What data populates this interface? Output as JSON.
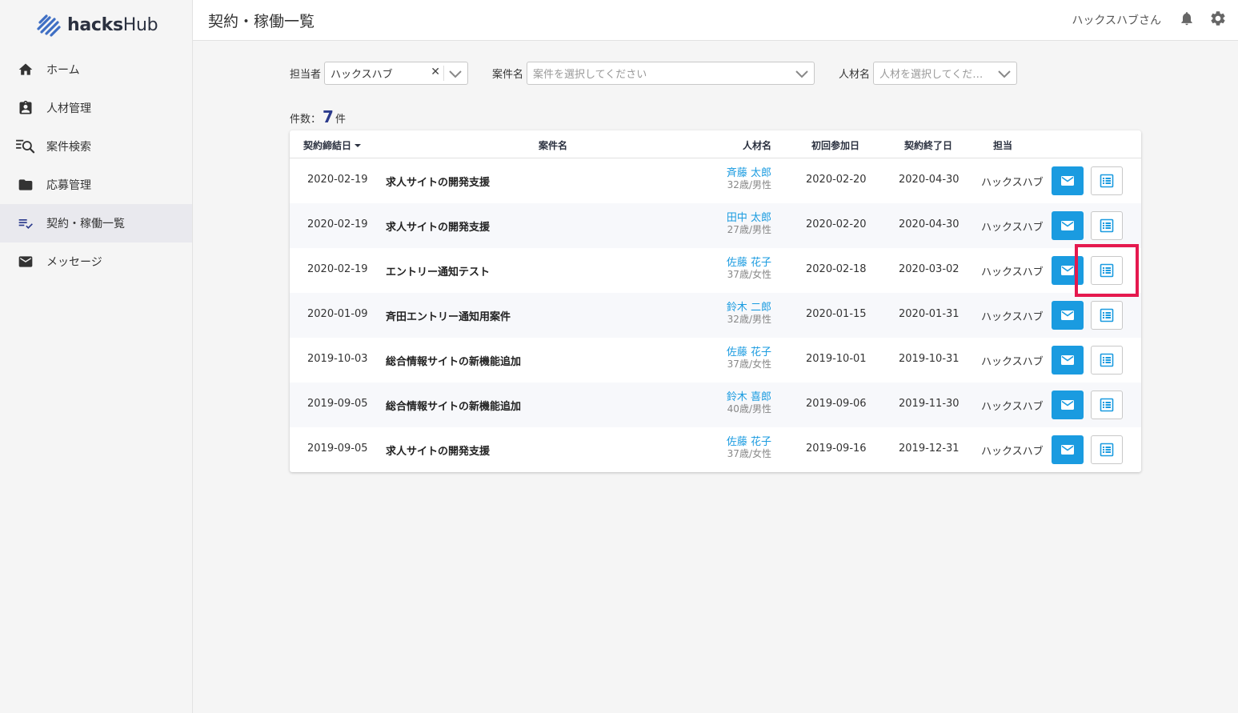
{
  "brand": {
    "name_bold": "hacks",
    "name_light": "Hub"
  },
  "sidebar": {
    "items": [
      {
        "label": "ホーム",
        "icon": "home-icon",
        "active": false
      },
      {
        "label": "人材管理",
        "icon": "badge-icon",
        "active": false
      },
      {
        "label": "案件検索",
        "icon": "search-list-icon",
        "active": false
      },
      {
        "label": "応募管理",
        "icon": "folder-icon",
        "active": false
      },
      {
        "label": "契約・稼働一覧",
        "icon": "checklist-icon",
        "active": true
      },
      {
        "label": "メッセージ",
        "icon": "mail-icon",
        "active": false
      }
    ]
  },
  "header": {
    "title": "契約・稼働一覧",
    "user": "ハックスハブさん"
  },
  "filters": {
    "manager_label": "担当者",
    "manager_value": "ハックスハブ",
    "project_label": "案件名",
    "project_placeholder": "案件を選択してください",
    "talent_label": "人材名",
    "talent_placeholder": "人材を選択してくだ…"
  },
  "count": {
    "prefix": "件数：",
    "value": "7",
    "suffix": "件"
  },
  "table": {
    "headers": {
      "contract_date": "契約締結日",
      "project": "案件名",
      "talent": "人材名",
      "first_day": "初回参加日",
      "end_date": "契約終了日",
      "manager": "担当"
    },
    "rows": [
      {
        "contract_date": "2020-02-19",
        "project": "求人サイトの開発支援",
        "name": "斉藤 太郎",
        "age_sex": "32歳/男性",
        "first_day": "2020-02-20",
        "end_date": "2020-04-30",
        "manager": "ハックスハブ"
      },
      {
        "contract_date": "2020-02-19",
        "project": "求人サイトの開発支援",
        "name": "田中 太郎",
        "age_sex": "27歳/男性",
        "first_day": "2020-02-20",
        "end_date": "2020-04-30",
        "manager": "ハックスハブ"
      },
      {
        "contract_date": "2020-02-19",
        "project": "エントリー通知テスト",
        "name": "佐藤 花子",
        "age_sex": "37歳/女性",
        "first_day": "2020-02-18",
        "end_date": "2020-03-02",
        "manager": "ハックスハブ"
      },
      {
        "contract_date": "2020-01-09",
        "project": "斉田エントリー通知用案件",
        "name": "鈴木 二郎",
        "age_sex": "32歳/男性",
        "first_day": "2020-01-15",
        "end_date": "2020-01-31",
        "manager": "ハックスハブ"
      },
      {
        "contract_date": "2019-10-03",
        "project": "総合情報サイトの新機能追加",
        "name": "佐藤 花子",
        "age_sex": "37歳/女性",
        "first_day": "2019-10-01",
        "end_date": "2019-10-31",
        "manager": "ハックスハブ"
      },
      {
        "contract_date": "2019-09-05",
        "project": "総合情報サイトの新機能追加",
        "name": "鈴木 喜郎",
        "age_sex": "40歳/男性",
        "first_day": "2019-09-06",
        "end_date": "2019-11-30",
        "manager": "ハックスハブ"
      },
      {
        "contract_date": "2019-09-05",
        "project": "求人サイトの開発支援",
        "name": "佐藤 花子",
        "age_sex": "37歳/女性",
        "first_day": "2019-09-16",
        "end_date": "2019-12-31",
        "manager": "ハックスハブ"
      }
    ]
  },
  "colors": {
    "accent": "#1a9be0",
    "highlight": "#e5194e",
    "count": "#2b3a8c"
  }
}
